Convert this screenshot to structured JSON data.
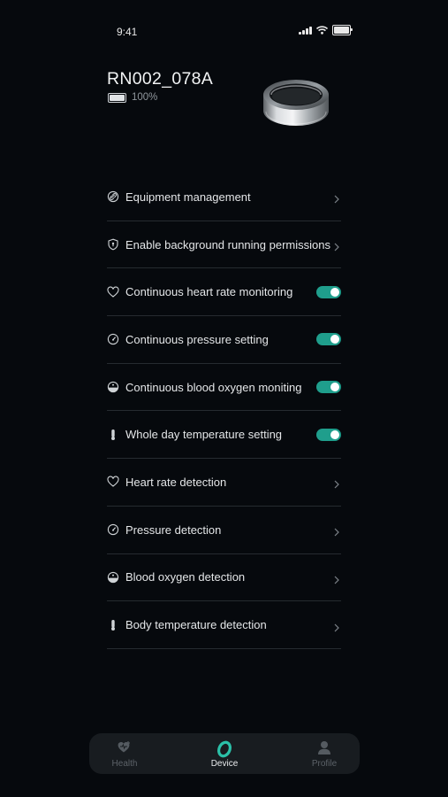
{
  "status_bar": {
    "time": "9:41"
  },
  "device": {
    "name": "RN002_078A",
    "battery_text": "100%",
    "battery_level": 1.0
  },
  "menu": [
    {
      "label": "Equipment management",
      "icon": "link-icon",
      "control": "chevron"
    },
    {
      "label": "Enable background running permissions",
      "icon": "shield-icon",
      "control": "chevron"
    },
    {
      "label": "Continuous heart rate monitoring",
      "icon": "heart-icon",
      "control": "toggle",
      "on": true
    },
    {
      "label": "Continuous pressure setting",
      "icon": "gauge-icon",
      "control": "toggle",
      "on": true
    },
    {
      "label": "Continuous blood oxygen moniting",
      "icon": "blood-oxygen-icon",
      "control": "toggle",
      "on": true
    },
    {
      "label": "Whole day temperature setting",
      "icon": "thermometer-icon",
      "control": "toggle",
      "on": true
    },
    {
      "label": "Heart rate detection",
      "icon": "heart-icon",
      "control": "chevron"
    },
    {
      "label": "Pressure detection",
      "icon": "gauge-icon",
      "control": "chevron"
    },
    {
      "label": "Blood oxygen detection",
      "icon": "blood-oxygen-icon",
      "control": "chevron"
    },
    {
      "label": "Body temperature detection",
      "icon": "thermometer-icon",
      "control": "chevron"
    }
  ],
  "tabs": [
    {
      "label": "Health",
      "icon": "heart-plus-icon",
      "active": false
    },
    {
      "label": "Device",
      "icon": "ring-icon",
      "active": true
    },
    {
      "label": "Profile",
      "icon": "person-icon",
      "active": false
    }
  ],
  "colors": {
    "background": "#06090d",
    "accent": "#1f9e8c",
    "divider": "#262b30",
    "tab_bar": "#181c20"
  }
}
